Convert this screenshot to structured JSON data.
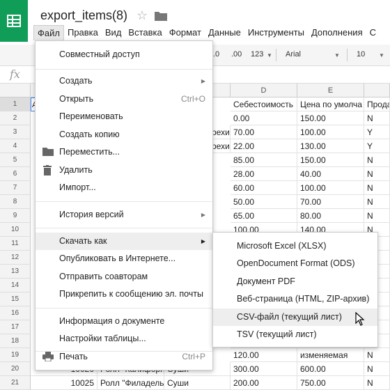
{
  "doc": {
    "title": "export_items(8)"
  },
  "menubar": [
    "Файл",
    "Правка",
    "Вид",
    "Вставка",
    "Формат",
    "Данные",
    "Инструменты",
    "Дополнения",
    "С"
  ],
  "toolbar": {
    "decimal_dec": ".0",
    "decimal_inc": ".00",
    "format_more": "123",
    "font": "Arial",
    "size": "10"
  },
  "formula": {
    "fx": "fx"
  },
  "columns": [
    "D",
    "E"
  ],
  "rows": [
    "1",
    "2",
    "3",
    "4",
    "5",
    "6",
    "7",
    "8",
    "9",
    "10",
    "11",
    "12",
    "13",
    "14",
    "15",
    "16",
    "17",
    "18",
    "19",
    "20",
    "21"
  ],
  "cells": {
    "r1": [
      "Себестоимость",
      "Цена по умолча",
      "Прода"
    ],
    "r2": [
      "0.00",
      "150.00",
      "N"
    ],
    "r3": [
      "70.00",
      "100.00",
      "Y"
    ],
    "r4": [
      "22.00",
      "130.00",
      "Y"
    ],
    "r5": [
      "85.00",
      "150.00",
      "N"
    ],
    "r6": [
      "28.00",
      "40.00",
      "N"
    ],
    "r7": [
      "60.00",
      "100.00",
      "N"
    ],
    "r8": [
      "50.00",
      "70.00",
      "N"
    ],
    "r9": [
      "65.00",
      "80.00",
      "N"
    ],
    "r10": [
      "100.00",
      "140.00",
      "N"
    ],
    "r19": [
      "120.00",
      "изменяемая",
      "N"
    ],
    "r20": [
      "300.00",
      "600.00",
      "N"
    ],
    "r21": [
      "200.00",
      "750.00",
      "N"
    ]
  },
  "partial": {
    "c3": "рехи",
    "c4": "рехи",
    "r20a": "10020",
    "r20b": "Ролл \"Калифорн",
    "r20c": "Суши",
    "r21a": "10025",
    "r21b": "Ролл \"Филадель",
    "r21c": "Суши",
    "a1": "A"
  },
  "file_menu": {
    "share": "Совместный доступ",
    "create": "Создать",
    "open": "Открыть",
    "open_sc": "Ctrl+O",
    "rename": "Переименовать",
    "copy": "Создать копию",
    "move": "Переместить...",
    "delete": "Удалить",
    "import": "Импорт...",
    "history": "История версий",
    "download": "Скачать как",
    "publish": "Опубликовать в Интернете...",
    "email": "Отправить соавторам",
    "attach": "Прикрепить к сообщению эл. почты",
    "info": "Информация о документе",
    "settings": "Настройки таблицы...",
    "print": "Печать",
    "print_sc": "Ctrl+P"
  },
  "download_menu": {
    "xlsx": "Microsoft Excel (XLSX)",
    "ods": "OpenDocument Format (ODS)",
    "pdf": "Документ PDF",
    "html": "Веб-страница (HTML, ZIP-архив)",
    "csv": "CSV-файл (текущий лист)",
    "tsv": "TSV (текущий лист)"
  },
  "colors": {
    "brand": "#0f9d58",
    "highlight": "#eeeeee"
  }
}
